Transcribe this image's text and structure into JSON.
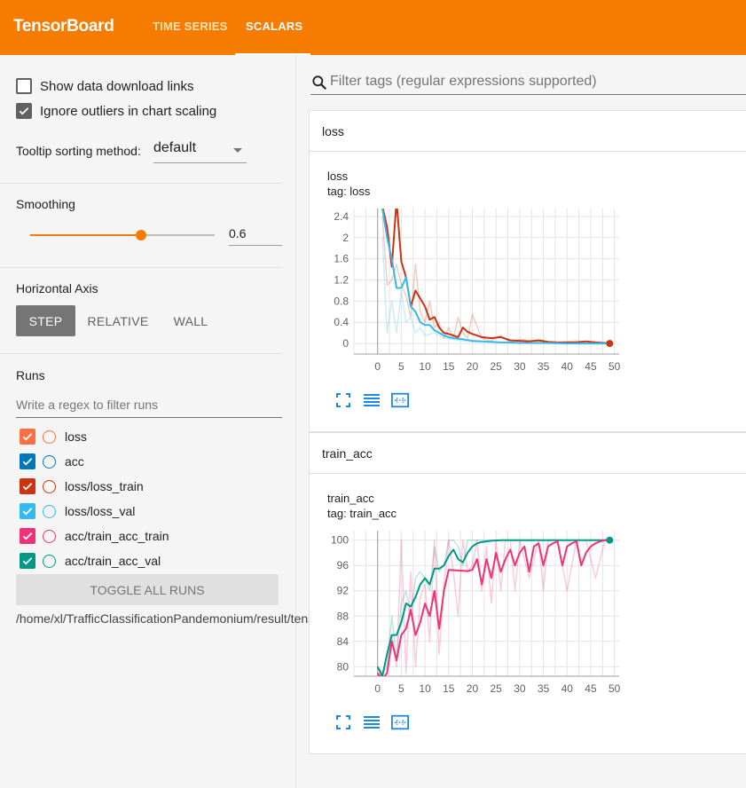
{
  "header": {
    "brand": "TensorBoard",
    "tabs": [
      {
        "label": "TIME SERIES",
        "active": false
      },
      {
        "label": "SCALARS",
        "active": true
      }
    ],
    "bg_color": "#f57c00"
  },
  "sidebar": {
    "show_download_links": {
      "label": "Show data download links",
      "checked": false
    },
    "ignore_outliers": {
      "label": "Ignore outliers in chart scaling",
      "checked": true
    },
    "tooltip_sorting": {
      "label": "Tooltip sorting method:",
      "value": "default"
    },
    "smoothing": {
      "title": "Smoothing",
      "value": "0.6",
      "fraction": 0.6
    },
    "horizontal_axis": {
      "title": "Horizontal Axis",
      "options": [
        "STEP",
        "RELATIVE",
        "WALL"
      ],
      "selected": "STEP"
    },
    "runs": {
      "title": "Runs",
      "filter_placeholder": "Write a regex to filter runs",
      "items": [
        {
          "name": "loss",
          "color": "#ff7043",
          "checked": true
        },
        {
          "name": "acc",
          "color": "#0077bb",
          "checked": true
        },
        {
          "name": "loss/loss_train",
          "color": "#cc3311",
          "checked": true
        },
        {
          "name": "loss/loss_val",
          "color": "#33bbee",
          "checked": true
        },
        {
          "name": "acc/train_acc_train",
          "color": "#ee3377",
          "checked": true
        },
        {
          "name": "acc/train_acc_val",
          "color": "#009988",
          "checked": true
        }
      ],
      "toggle_all_label": "TOGGLE ALL RUNS",
      "logdir": "/home/xl/TrafficClassificationPandemonium/result/tensorboard"
    }
  },
  "main": {
    "filter_placeholder": "Filter tags (regular expressions supported)",
    "cards": [
      {
        "title": "loss",
        "chart_title": "loss",
        "chart_tag": "tag: loss"
      },
      {
        "title": "train_acc",
        "chart_title": "train_acc",
        "chart_tag": "tag: train_acc"
      }
    ]
  },
  "chart_data": [
    {
      "type": "line",
      "title": "loss",
      "subtitle": "tag: loss",
      "xlabel": "",
      "ylabel": "",
      "xlim": [
        -5,
        51
      ],
      "ylim": [
        -0.2,
        2.55
      ],
      "xticks": [
        0,
        5,
        10,
        15,
        20,
        25,
        30,
        35,
        40,
        45,
        50
      ],
      "yticks": [
        0,
        0.4,
        0.8,
        1.2,
        1.6,
        2,
        2.4
      ],
      "grid": true,
      "series": [
        {
          "name": "loss/loss_train",
          "color": "#cc3311",
          "role": "smoothed",
          "x": [
            1,
            2,
            3,
            4,
            5,
            6,
            7,
            8,
            9,
            10,
            11,
            12,
            13,
            14,
            15,
            16,
            17,
            18,
            19,
            20,
            22,
            24,
            26,
            28,
            30,
            32,
            34,
            36,
            38,
            40,
            42,
            44,
            46,
            48,
            49
          ],
          "y": [
            2.6,
            2.2,
            1.45,
            2.7,
            1.55,
            1.25,
            0.7,
            1.0,
            0.85,
            0.7,
            0.45,
            0.5,
            0.3,
            0.2,
            0.18,
            0.15,
            0.12,
            0.3,
            0.22,
            0.18,
            0.12,
            0.1,
            0.12,
            0.06,
            0.05,
            0.04,
            0.06,
            0.03,
            0.02,
            0.02,
            0.02,
            0.04,
            0.02,
            0.01,
            0.0
          ]
        },
        {
          "name": "loss/loss_val",
          "color": "#33bbee",
          "role": "smoothed",
          "x": [
            1,
            2,
            3,
            4,
            5,
            6,
            7,
            8,
            9,
            10,
            11,
            12,
            13,
            14,
            15,
            16,
            18,
            20,
            22,
            24,
            26,
            28,
            30,
            32,
            36,
            40,
            44,
            48,
            49
          ],
          "y": [
            2.55,
            2.0,
            1.6,
            1.05,
            1.05,
            1.25,
            0.7,
            0.6,
            0.4,
            0.35,
            0.35,
            0.25,
            0.2,
            0.15,
            0.12,
            0.1,
            0.08,
            0.05,
            0.04,
            0.03,
            0.02,
            0.02,
            0.01,
            0.01,
            0.01,
            0.0,
            0.0,
            0.0,
            0.0
          ]
        },
        {
          "name": "loss/loss_train",
          "color": "#cc3311",
          "role": "raw",
          "x": [
            1,
            2,
            3,
            4,
            5,
            6,
            7,
            8,
            9,
            10,
            11,
            12,
            13,
            14,
            15,
            16,
            17,
            18,
            19,
            20,
            22,
            24,
            26,
            28,
            30,
            34,
            38,
            42,
            46,
            49
          ],
          "y": [
            2.4,
            1.1,
            1.2,
            1.5,
            1.1,
            0.9,
            0.5,
            1.5,
            0.6,
            0.4,
            0.8,
            0.3,
            0.4,
            0.1,
            0.3,
            0.1,
            0.5,
            0.2,
            0.1,
            0.55,
            0.1,
            0.05,
            0.15,
            0.02,
            0.08,
            0.03,
            0.02,
            0.05,
            0.01,
            0.0
          ]
        },
        {
          "name": "loss/loss_val",
          "color": "#33bbee",
          "role": "raw",
          "x": [
            1,
            2,
            3,
            4,
            5,
            6,
            7,
            8,
            9,
            10,
            12,
            14,
            16,
            18,
            20,
            25,
            30,
            40,
            49
          ],
          "y": [
            2.0,
            0.2,
            0.8,
            0.2,
            1.0,
            0.4,
            0.5,
            0.2,
            0.3,
            0.15,
            0.2,
            0.1,
            0.08,
            0.05,
            0.03,
            0.02,
            0.01,
            0.0,
            0.0
          ]
        }
      ]
    },
    {
      "type": "line",
      "title": "train_acc",
      "subtitle": "tag: train_acc",
      "xlabel": "",
      "ylabel": "",
      "xlim": [
        -5,
        51
      ],
      "ylim": [
        78.5,
        101.5
      ],
      "xticks": [
        0,
        5,
        10,
        15,
        20,
        25,
        30,
        35,
        40,
        45,
        50
      ],
      "yticks": [
        80,
        84,
        88,
        92,
        96,
        100
      ],
      "grid": true,
      "series": [
        {
          "name": "acc/train_acc_val",
          "color": "#009988",
          "role": "smoothed",
          "x": [
            0,
            1,
            2,
            3,
            4,
            5,
            6,
            7,
            8,
            9,
            10,
            11,
            12,
            13,
            14,
            15,
            16,
            17,
            18,
            19,
            20,
            21,
            22,
            24,
            26,
            28,
            30,
            35,
            40,
            45,
            49
          ],
          "y": [
            80,
            78.5,
            82,
            85,
            85,
            87,
            90,
            89.5,
            91,
            93,
            94,
            93,
            95.5,
            95.5,
            96,
            97.5,
            98.5,
            97,
            96.5,
            98,
            99,
            99.5,
            99.7,
            99.9,
            100,
            100,
            100,
            100,
            100,
            100,
            100
          ]
        },
        {
          "name": "acc/train_acc_train",
          "color": "#ee3377",
          "role": "smoothed",
          "x": [
            0,
            1,
            2,
            3,
            4,
            5,
            6,
            7,
            8,
            9,
            10,
            11,
            12,
            13,
            14,
            15,
            17,
            19,
            20,
            21,
            22,
            23,
            24,
            25,
            26,
            27,
            28,
            29,
            30,
            31,
            32,
            33,
            34,
            35,
            36,
            37,
            38,
            39,
            40,
            41,
            42,
            43,
            44,
            45,
            46,
            47,
            48,
            49
          ],
          "y": [
            79,
            78,
            79,
            84,
            81,
            85,
            86,
            89,
            85,
            87,
            90,
            88,
            92,
            86,
            92,
            95.3,
            95.2,
            95.1,
            95.3,
            97,
            93,
            97,
            94,
            98,
            95,
            97,
            98.5,
            96,
            98,
            99,
            95,
            99,
            99.5,
            96,
            99,
            99.5,
            99.8,
            96,
            99,
            99.5,
            99.8,
            96,
            98,
            99,
            99.5,
            99.8,
            100,
            100
          ]
        },
        {
          "name": "acc/train_acc_val",
          "color": "#009988",
          "role": "raw",
          "x": [
            0,
            1,
            2,
            3,
            4,
            5,
            6,
            7,
            8,
            9,
            10,
            11,
            12,
            13,
            14,
            15,
            16,
            17,
            18,
            19,
            20,
            22,
            25,
            30,
            40,
            49
          ],
          "y": [
            80,
            79,
            80,
            88,
            81,
            90,
            92,
            88,
            94,
            95,
            94,
            92,
            99,
            95,
            96,
            100,
            100,
            99,
            96,
            100,
            100,
            100,
            100,
            100,
            100,
            100
          ]
        },
        {
          "name": "acc/train_acc_train",
          "color": "#ee3377",
          "role": "raw",
          "x": [
            0,
            1,
            2,
            3,
            4,
            5,
            6,
            7,
            8,
            9,
            10,
            11,
            12,
            13,
            14,
            15,
            16,
            17,
            18,
            19,
            20,
            21,
            22,
            23,
            24,
            25,
            26,
            27,
            28,
            29,
            30,
            32,
            34,
            35,
            36,
            38,
            40,
            42,
            44,
            46,
            48,
            49
          ],
          "y": [
            80,
            78,
            79,
            85,
            80,
            100,
            79,
            95,
            80,
            91,
            93,
            84,
            100,
            82,
            93,
            100,
            95,
            88,
            100,
            95,
            96,
            100,
            92,
            99,
            90,
            100,
            92,
            100,
            100,
            92,
            100,
            94,
            100,
            92,
            100,
            100,
            92,
            100,
            100,
            94,
            100,
            100
          ]
        }
      ]
    }
  ]
}
